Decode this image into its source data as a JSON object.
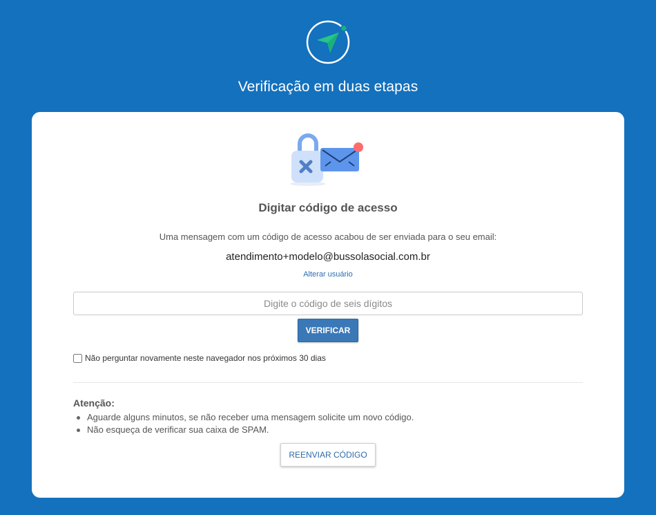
{
  "header": {
    "title": "Verificação em duas etapas"
  },
  "card": {
    "title": "Digitar código de acesso",
    "info_text": "Uma mensagem com um código de acesso acabou de ser enviada para o seu email:",
    "email": "atendimento+modelo@bussolasocial.com.br",
    "change_user_label": "Alterar usuário",
    "code_input": {
      "placeholder": "Digite o código de seis dígitos",
      "value": ""
    },
    "verify_label": "VERIFICAR",
    "remember_label": "Não perguntar novamente neste navegador nos próximos 30 dias",
    "remember_checked": false,
    "attention_title": "Atenção:",
    "attention_items": [
      "Aguarde alguns minutos, se não receber uma mensagem solicite um novo código.",
      "Não esqueça de verificar sua caixa de SPAM."
    ],
    "resend_label": "REENVIAR CÓDIGO"
  },
  "icons": {
    "logo": "compass-arrow-icon",
    "illustration": "lock-and-envelope-icon"
  },
  "colors": {
    "background": "#1471bd",
    "primary_button": "#3a78b8",
    "logo_green": "#1bb07a",
    "notification_dot": "#ff6b6b"
  }
}
